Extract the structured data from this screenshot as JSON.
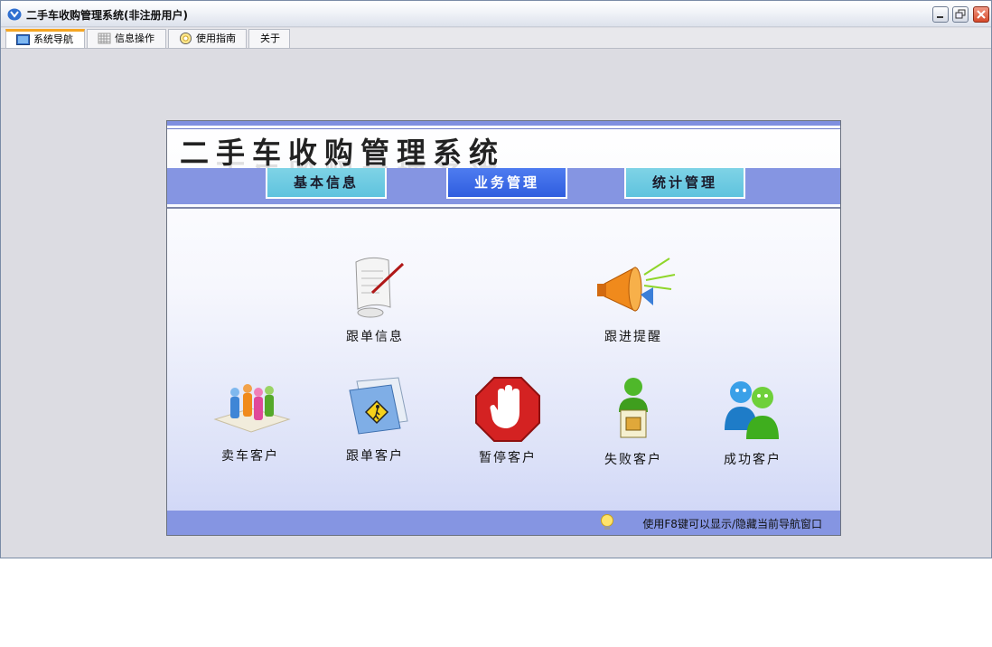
{
  "window": {
    "title": "二手车收购管理系统(非注册用户)"
  },
  "tabs": [
    {
      "label": "系统导航",
      "icon": "monitor-icon",
      "active": true
    },
    {
      "label": "信息操作",
      "icon": "grid-icon",
      "active": false
    },
    {
      "label": "使用指南",
      "icon": "help-icon",
      "active": false
    },
    {
      "label": "关于",
      "icon": "",
      "active": false
    }
  ],
  "panel": {
    "title": "二手车收购管理系统",
    "nav": [
      {
        "label": "基本信息",
        "active": false
      },
      {
        "label": "业务管理",
        "active": true
      },
      {
        "label": "统计管理",
        "active": false
      }
    ],
    "row1": [
      {
        "label": "跟单信息",
        "icon": "scroll-quill-icon"
      },
      {
        "label": "跟进提醒",
        "icon": "megaphone-icon"
      }
    ],
    "row2": [
      {
        "label": "卖车客户",
        "icon": "people-group-icon"
      },
      {
        "label": "跟单客户",
        "icon": "folder-pedestrian-icon"
      },
      {
        "label": "暂停客户",
        "icon": "stop-hand-icon"
      },
      {
        "label": "失败客户",
        "icon": "person-box-icon"
      },
      {
        "label": "成功客户",
        "icon": "two-users-icon"
      }
    ],
    "hint": "使用F8键可以显示/隐藏当前导航窗口"
  },
  "colors": {
    "nav_active": "#2f5ddf",
    "nav_inactive": "#5ec3de",
    "band": "#8595e2"
  }
}
